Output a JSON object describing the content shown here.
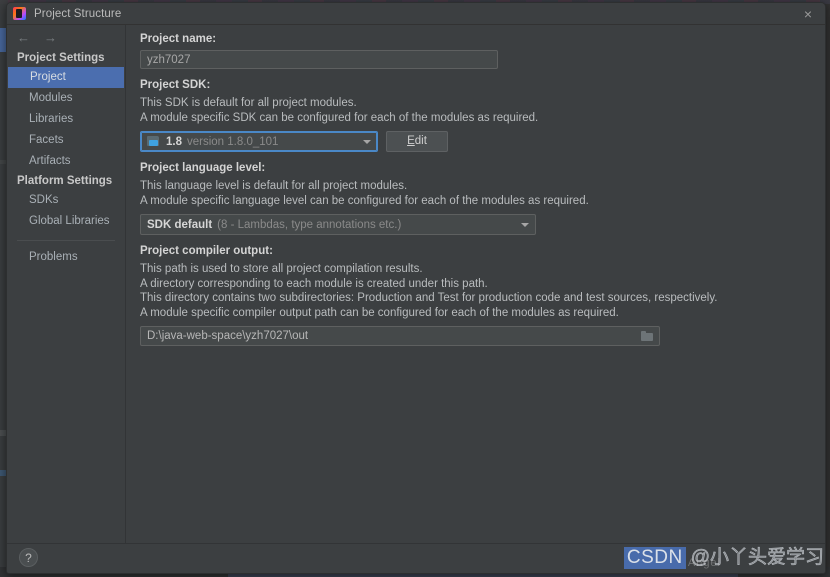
{
  "window": {
    "title": "Project Structure",
    "logo_icon": "intellij-idea-icon",
    "close_icon": "×"
  },
  "nav": {
    "back_icon": "←",
    "forward_icon": "→"
  },
  "sidebar": {
    "groups": [
      {
        "header": "Project Settings",
        "items": [
          {
            "label": "Project",
            "selected": true
          },
          {
            "label": "Modules",
            "selected": false
          },
          {
            "label": "Libraries",
            "selected": false
          },
          {
            "label": "Facets",
            "selected": false
          },
          {
            "label": "Artifacts",
            "selected": false
          }
        ]
      },
      {
        "header": "Platform Settings",
        "items": [
          {
            "label": "SDKs",
            "selected": false
          },
          {
            "label": "Global Libraries",
            "selected": false
          }
        ]
      }
    ],
    "problems_label": "Problems"
  },
  "main": {
    "project_name": {
      "label": "Project name:",
      "value": "yzh7027"
    },
    "project_sdk": {
      "label": "Project SDK:",
      "desc_line1": "This SDK is default for all project modules.",
      "desc_line2": "A module specific SDK can be configured for each of the modules as required.",
      "selected_main": "1.8",
      "selected_sub": "version 1.8.0_101",
      "sdk_icon": "java-sdk-folder-icon",
      "dropdown_icon": "chevron-down-icon",
      "edit_button": "Edit",
      "edit_button_mnemonic": "E",
      "edit_button_rest": "dit"
    },
    "language_level": {
      "label": "Project language level:",
      "desc_line1": "This language level is default for all project modules.",
      "desc_line2": "A module specific language level can be configured for each of the modules as required.",
      "selected_main": "SDK default",
      "selected_sub": "(8 - Lambdas, type annotations etc.)",
      "dropdown_icon": "chevron-down-icon"
    },
    "compiler_output": {
      "label": "Project compiler output:",
      "desc_line1": "This path is used to store all project compilation results.",
      "desc_line2": "A directory corresponding to each module is created under this path.",
      "desc_line3": "This directory contains two subdirectories: Production and Test for production code and test sources, respectively.",
      "desc_line4": "A module specific compiler output path can be configured for each of the modules as required.",
      "path_value": "D:\\java-web-space\\yzh7027\\out",
      "browse_icon": "folder-browse-icon"
    }
  },
  "footer": {
    "help_label": "?",
    "help_icon": "help-question-icon"
  },
  "watermark": {
    "badge": "CSDN",
    "handle": "@小丫头爱学习",
    "ghost": "Angel"
  },
  "colors": {
    "accent_selection": "#4b6eaf",
    "dialog_bg": "#3c3f41",
    "field_bg": "#45494a",
    "focus_border": "#4a88c7",
    "watermark_badge": "#4a6fb5"
  }
}
